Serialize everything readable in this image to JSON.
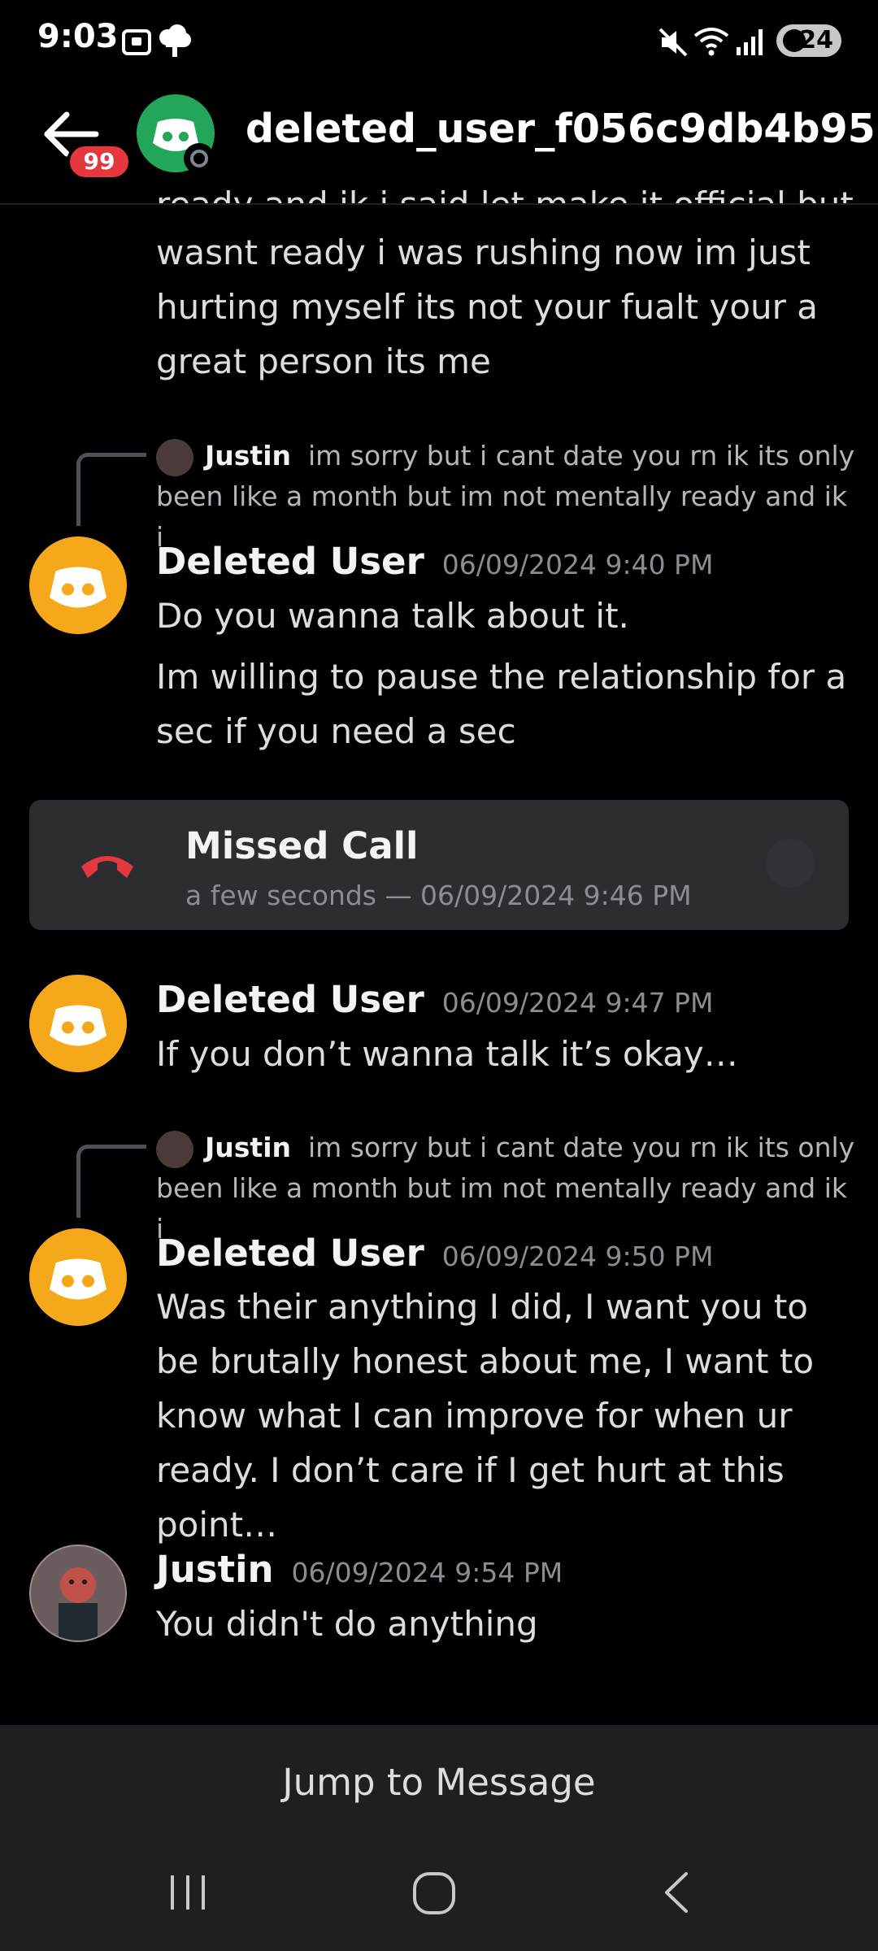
{
  "status_bar": {
    "time": "9:03",
    "battery": "24"
  },
  "header": {
    "unread_badge": "99",
    "title": "deleted_user_f056c9db4b95"
  },
  "messages": {
    "m0": {
      "partial_line": "ready and ik i said let make it official but i",
      "text": "wasnt ready i was rushing now im just hurting myself its not your fualt your a great person its me"
    },
    "reply1": {
      "name": "Justin",
      "text": "im sorry but i cant date you rn ik its only been like a month but im not mentally ready and ik i"
    },
    "m1": {
      "author": "Deleted User",
      "timestamp": "06/09/2024 9:40 PM",
      "line1": "Do you wanna talk about it.",
      "line2": "Im willing to pause the relationship for a sec if you need a sec"
    },
    "call": {
      "title": "Missed Call",
      "subtitle": "a few seconds — 06/09/2024 9:46 PM"
    },
    "m2": {
      "author": "Deleted User",
      "timestamp": "06/09/2024 9:47 PM",
      "text": "If you don’t wanna talk it’s okay…"
    },
    "reply2": {
      "name": "Justin",
      "text": "im sorry but i cant date you rn ik its only been like a month but im not mentally ready and ik i"
    },
    "m3": {
      "author": "Deleted User",
      "timestamp": "06/09/2024 9:50 PM",
      "text": "Was their anything I did, I want you to be brutally honest about me, I want to know what I can improve for when ur ready. I don’t care if I get hurt at this point…"
    },
    "m4": {
      "author": "Justin",
      "timestamp": "06/09/2024 9:54 PM",
      "text": "You didn't do anything"
    }
  },
  "jump_bar": {
    "label": "Jump to Message"
  },
  "colors": {
    "bot_avatar": "#f6a81b",
    "header_avatar": "#23a55a",
    "badge": "#e5373e",
    "missed_call": "#e5373e"
  },
  "icons": [
    "back-arrow-icon",
    "discord-logo-icon",
    "screenshot-icon",
    "cloud-icon",
    "mute-icon",
    "wifi-icon",
    "signal-icon",
    "hangup-phone-icon",
    "recents-nav-icon",
    "home-nav-icon",
    "back-nav-icon"
  ]
}
